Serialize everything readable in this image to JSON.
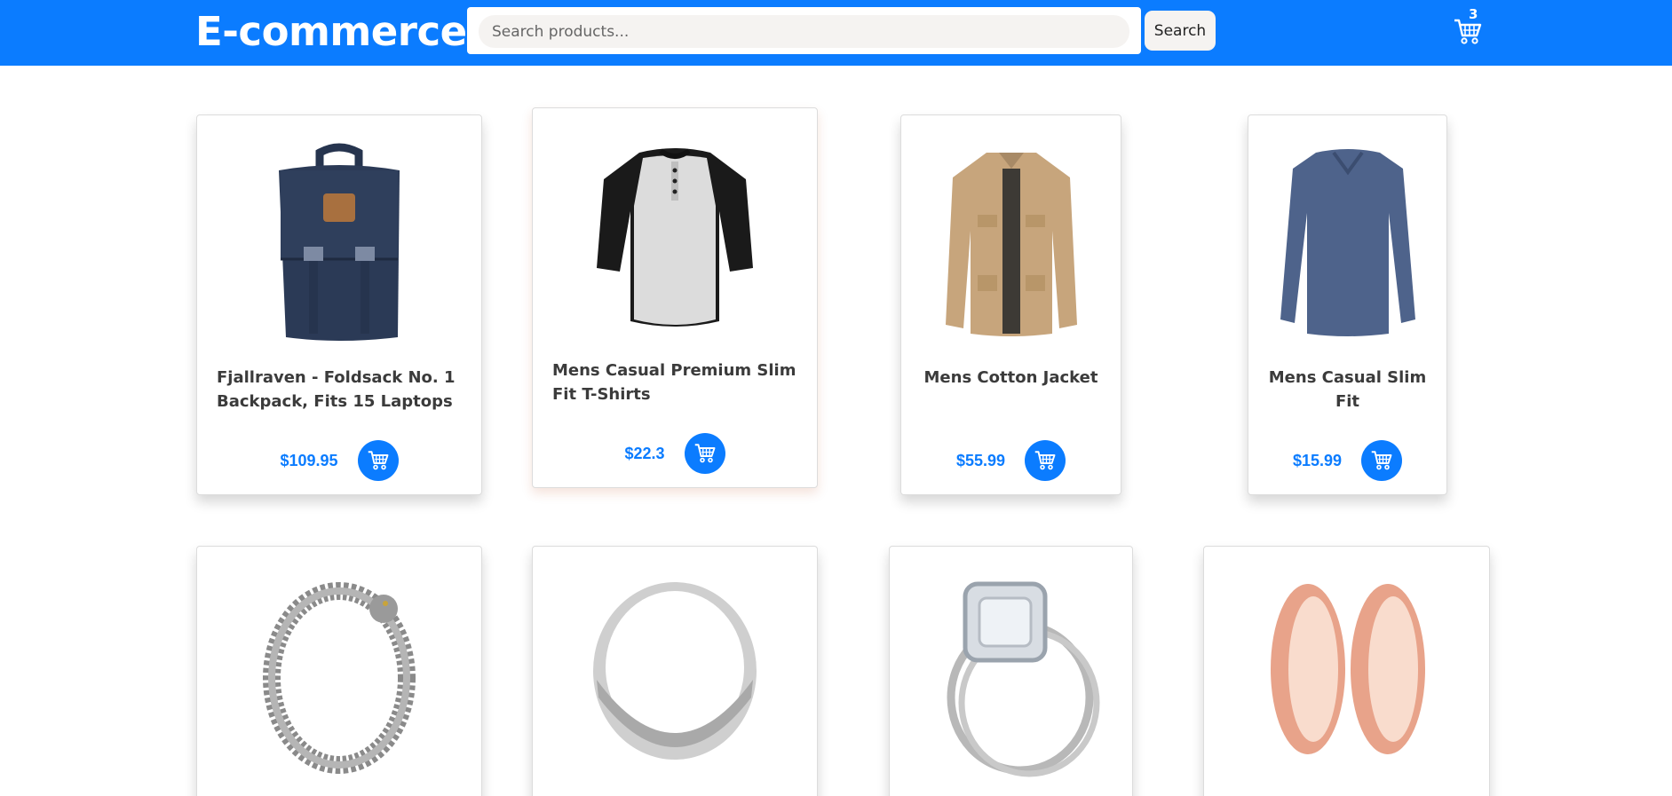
{
  "header": {
    "brand": "E-commerce",
    "search_placeholder": "Search products...",
    "search_button": "Search",
    "cart_count": "3",
    "cart_icon": "shopping-cart-icon"
  },
  "colors": {
    "accent": "#0b7cff",
    "header_bg": "#0b7cff",
    "price": "#0b7cff"
  },
  "products": [
    {
      "title": "Fjallraven - Foldsack No. 1 Backpack, Fits 15 Laptops",
      "price": "$109.95",
      "image": "backpack-image"
    },
    {
      "title": "Mens Casual Premium Slim Fit T-Shirts",
      "price": "$22.3",
      "image": "tshirt-image"
    },
    {
      "title": "Mens Cotton Jacket",
      "price": "$55.99",
      "image": "jacket-image"
    },
    {
      "title": "Mens Casual Slim Fit",
      "price": "$15.99",
      "image": "long-sleeve-shirt-image"
    },
    {
      "title": "",
      "price": "",
      "image": "bracelet-image"
    },
    {
      "title": "",
      "price": "",
      "image": "ring-image"
    },
    {
      "title": "",
      "price": "",
      "image": "diamond-ring-image"
    },
    {
      "title": "",
      "price": "",
      "image": "earrings-image"
    }
  ]
}
